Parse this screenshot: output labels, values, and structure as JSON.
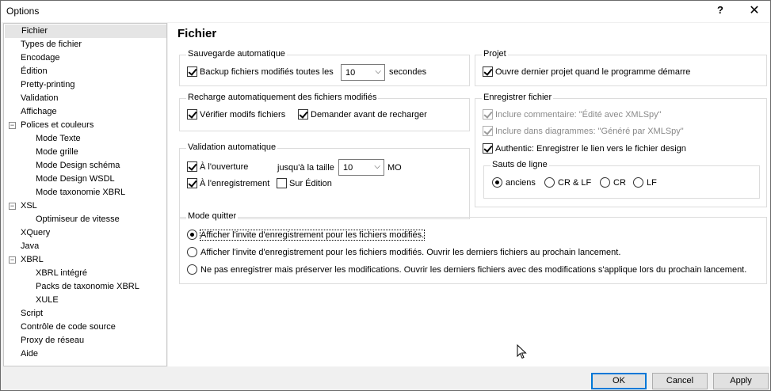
{
  "window": {
    "title": "Options",
    "help": "?",
    "close": "✕"
  },
  "tree": {
    "items": [
      {
        "label": "Fichier",
        "selected": true
      },
      {
        "label": "Types de fichier"
      },
      {
        "label": "Encodage"
      },
      {
        "label": "Édition"
      },
      {
        "label": "Pretty-printing"
      },
      {
        "label": "Validation"
      },
      {
        "label": "Affichage"
      },
      {
        "label": "Polices et couleurs",
        "expander": "−"
      },
      {
        "label": "Mode Texte"
      },
      {
        "label": "Mode grille"
      },
      {
        "label": "Mode Design schéma"
      },
      {
        "label": "Mode Design WSDL"
      },
      {
        "label": "Mode taxonomie XBRL"
      },
      {
        "label": "XSL",
        "expander": "−"
      },
      {
        "label": "Optimiseur de vitesse"
      },
      {
        "label": "XQuery"
      },
      {
        "label": "Java"
      },
      {
        "label": "XBRL",
        "expander": "−"
      },
      {
        "label": "XBRL intégré"
      },
      {
        "label": "Packs de taxonomie XBRL"
      },
      {
        "label": "XULE"
      },
      {
        "label": "Script"
      },
      {
        "label": "Contrôle de code source"
      },
      {
        "label": "Proxy de réseau"
      },
      {
        "label": "Aide"
      }
    ]
  },
  "page": {
    "title": "Fichier"
  },
  "autosave": {
    "title": "Sauvegarde automatique",
    "backup_label": "Backup fichiers modifiés toutes les",
    "interval_value": "10",
    "unit": "secondes"
  },
  "reload": {
    "title": "Recharge automatiquement des fichiers modifiés",
    "check_label": "Vérifier modifs fichiers",
    "ask_label": "Demander avant de recharger"
  },
  "validation": {
    "title": "Validation automatique",
    "on_open_label": "À l'ouverture",
    "size_label": "jusqu'à la taille",
    "size_value": "10",
    "size_unit": "MO",
    "on_save_label": "À l'enregistrement",
    "on_edit_label": "Sur Édition"
  },
  "project": {
    "title": "Projet",
    "open_last_label": "Ouvre dernier projet quand le programme démarre"
  },
  "save_file": {
    "title": "Enregistrer fichier",
    "comment_label": "Inclure commentaire: \"Édité avec XMLSpy\"",
    "diagrams_label": "Inclure dans diagrammes: \"Généré par XMLSpy\"",
    "authentic_label": "Authentic: Enregistrer le lien vers le fichier design"
  },
  "line_breaks": {
    "title": "Sauts de ligne",
    "options": [
      "anciens",
      "CR & LF",
      "CR",
      "LF"
    ]
  },
  "quit_mode": {
    "title": "Mode quitter",
    "options": [
      "Afficher l'invite d'enregistrement pour les fichiers modifiés.",
      "Afficher l'invite d'enregistrement pour les fichiers modifiés. Ouvrir les derniers fichiers au prochain lancement.",
      "Ne pas enregistrer mais préserver les modifications. Ouvrir les derniers fichiers avec des modifications s'applique lors du prochain lancement."
    ]
  },
  "buttons": {
    "ok": "OK",
    "cancel": "Cancel",
    "apply": "Apply"
  }
}
